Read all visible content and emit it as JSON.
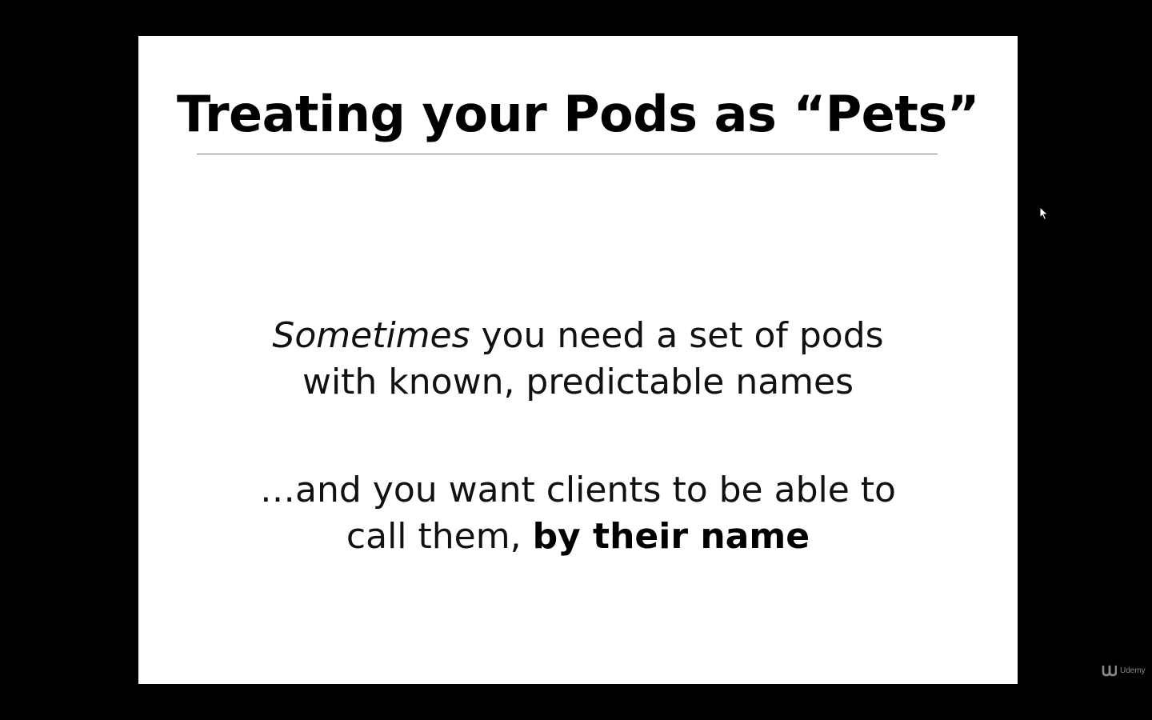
{
  "slide": {
    "title": "Treating your Pods as “Pets”",
    "paragraph_1": {
      "line_1_italic": "Sometimes",
      "line_1_rest": " you need a set of pods",
      "line_2": "with known, predictable names"
    },
    "paragraph_2": {
      "line_1": "…and you want clients to be able to",
      "line_2_plain": "call them, ",
      "line_2_bold": "by their name"
    }
  },
  "overlay": {
    "cursor_icon": "mouse-pointer-icon",
    "watermark_logo": "udemy-logo-icon",
    "watermark_text": "Udemy"
  },
  "colors": {
    "background": "#000000",
    "slide": "#ffffff",
    "text": "#000000",
    "rule": "#7a7a7a",
    "watermark": "#8a8a8a"
  }
}
